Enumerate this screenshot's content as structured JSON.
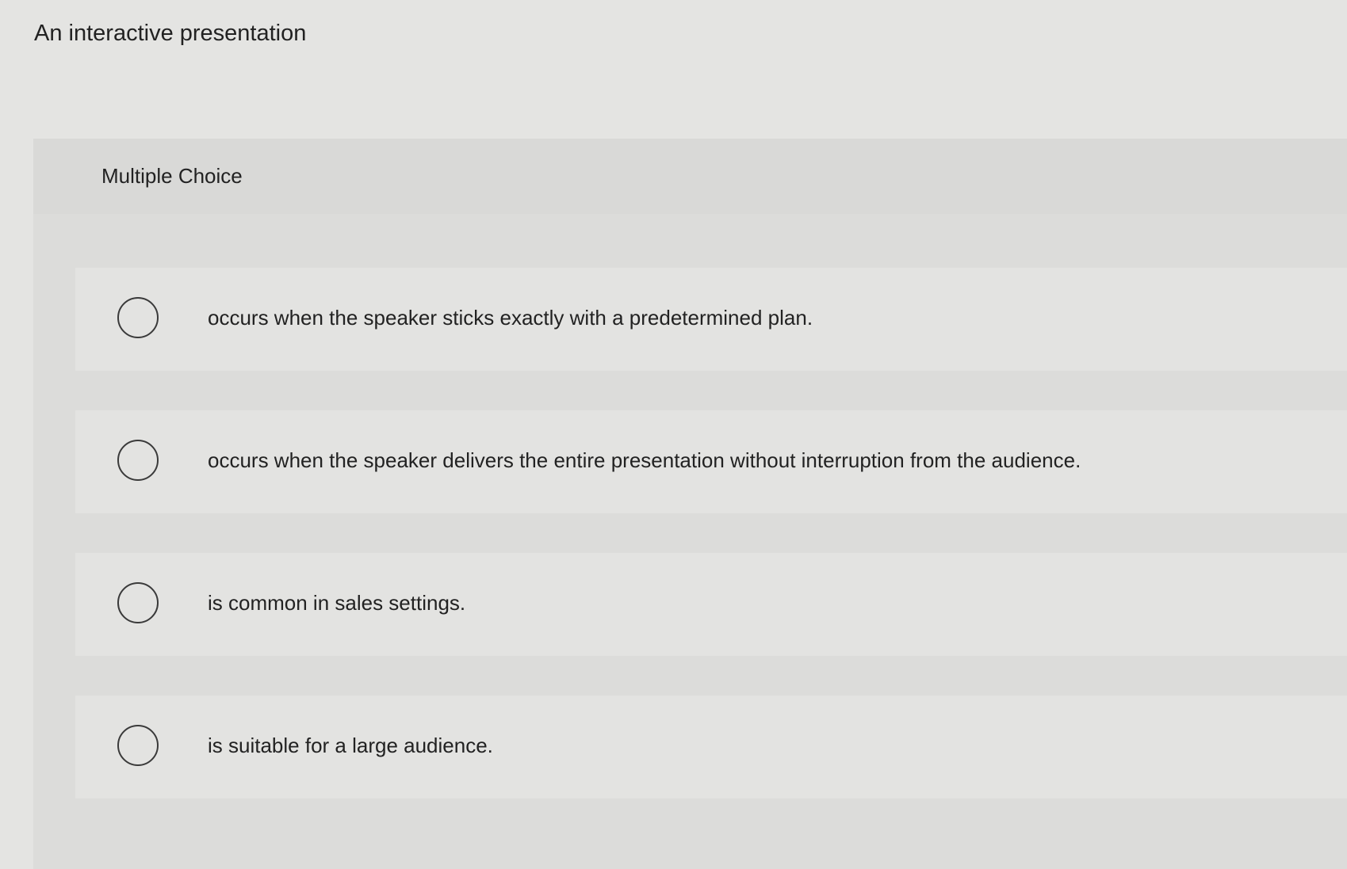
{
  "question": {
    "stem": "An interactive presentation",
    "type_label": "Multiple Choice",
    "choices": [
      {
        "label": "occurs when the speaker sticks exactly with a predetermined plan.",
        "selected": false
      },
      {
        "label": "occurs when the speaker delivers the entire presentation without interruption from the audience.",
        "selected": false
      },
      {
        "label": "is common in sales settings.",
        "selected": false
      },
      {
        "label": "is suitable for a large audience.",
        "selected": false
      }
    ]
  },
  "icons": {
    "radio": "radio-circle-icon"
  }
}
